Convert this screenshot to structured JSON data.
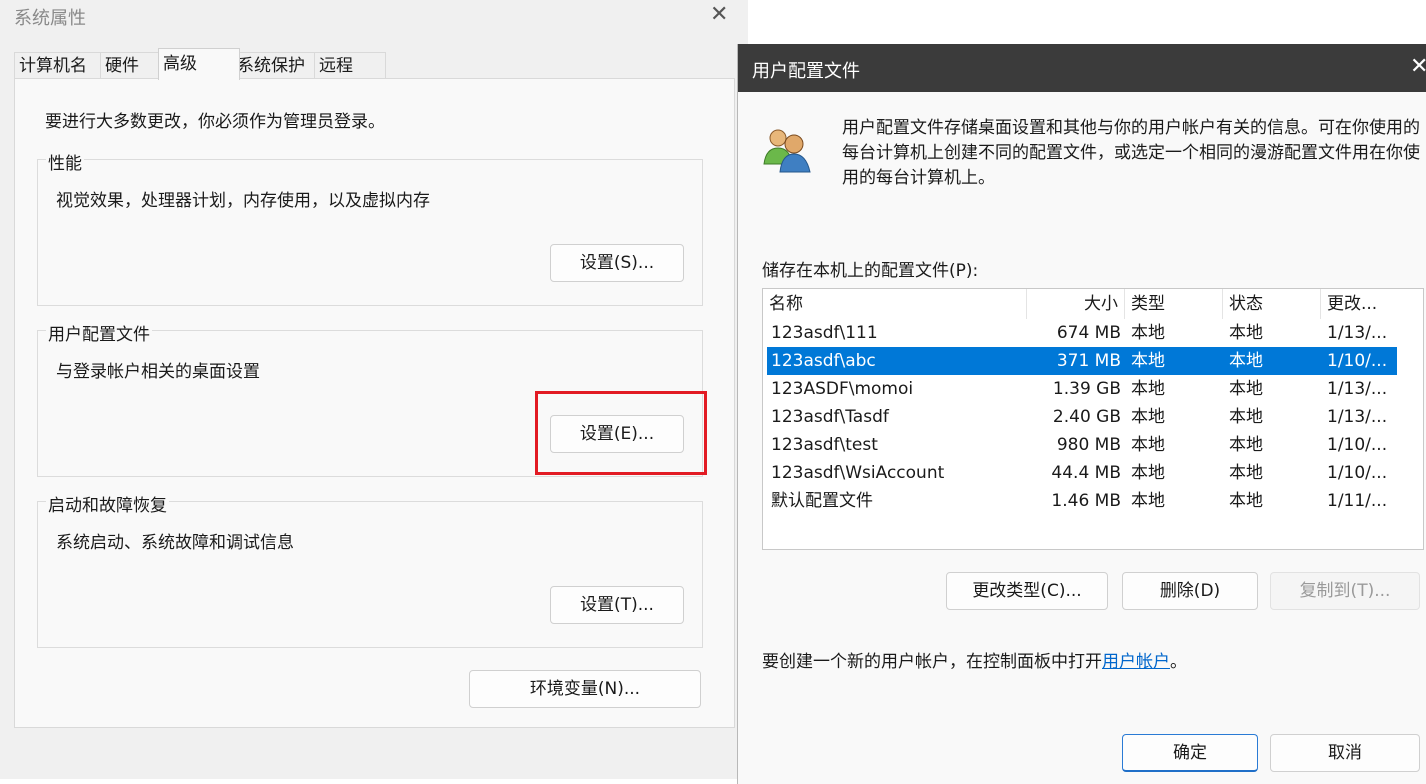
{
  "system_properties": {
    "title": "系统属性",
    "close_label": "✕",
    "tabs": [
      {
        "label": "计算机名"
      },
      {
        "label": "硬件"
      },
      {
        "label": "高级"
      },
      {
        "label": "系统保护"
      },
      {
        "label": "远程"
      }
    ],
    "active_tab": "高级",
    "admin_note": "要进行大多数更改，你必须作为管理员登录。",
    "performance": {
      "label": "性能",
      "description": "视觉效果，处理器计划，内存使用，以及虚拟内存",
      "button": "设置(S)..."
    },
    "user_profiles": {
      "label": "用户配置文件",
      "description": "与登录帐户相关的桌面设置",
      "button": "设置(E)..."
    },
    "startup_recovery": {
      "label": "启动和故障恢复",
      "description": "系统启动、系统故障和调试信息",
      "button": "设置(T)..."
    },
    "env_button": "环境变量(N)...",
    "highlight_color": "#e21b24"
  },
  "user_profiles_dialog": {
    "title": "用户配置文件",
    "close_label": "✕",
    "description": "用户配置文件存储桌面设置和其他与你的用户帐户有关的信息。可在你使用的每台计算机上创建不同的配置文件，或选定一个相同的漫游配置文件用在你使用的每台计算机上。",
    "icon": "users-icon",
    "list_label": "储存在本机上的配置文件(P):",
    "columns": {
      "name": "名称",
      "size": "大小",
      "type": "类型",
      "status": "状态",
      "modified": "更改..."
    },
    "rows": [
      {
        "name": "123asdf\\111",
        "size": "674 MB",
        "type": "本地",
        "status": "本地",
        "modified": "1/13/..."
      },
      {
        "name": "123asdf\\abc",
        "size": "371 MB",
        "type": "本地",
        "status": "本地",
        "modified": "1/10/..."
      },
      {
        "name": "123ASDF\\momoi",
        "size": "1.39 GB",
        "type": "本地",
        "status": "本地",
        "modified": "1/13/..."
      },
      {
        "name": "123asdf\\Tasdf",
        "size": "2.40 GB",
        "type": "本地",
        "status": "本地",
        "modified": "1/13/..."
      },
      {
        "name": "123asdf\\test",
        "size": "980 MB",
        "type": "本地",
        "status": "本地",
        "modified": "1/10/..."
      },
      {
        "name": "123asdf\\WsiAccount",
        "size": "44.4 MB",
        "type": "本地",
        "status": "本地",
        "modified": "1/10/..."
      },
      {
        "name": "默认配置文件",
        "size": "1.46 MB",
        "type": "本地",
        "status": "本地",
        "modified": "1/11/..."
      }
    ],
    "selected_row": "123asdf\\abc",
    "buttons": {
      "change_type": "更改类型(C)...",
      "delete": "删除(D)",
      "copy_to": "复制到(T)..."
    },
    "create_note_prefix": "要创建一个新的用户帐户，在控制面板中打开",
    "create_note_link": "用户帐户",
    "create_note_suffix": "。",
    "ok": "确定",
    "cancel": "取消",
    "selection_color": "#0078d7"
  }
}
